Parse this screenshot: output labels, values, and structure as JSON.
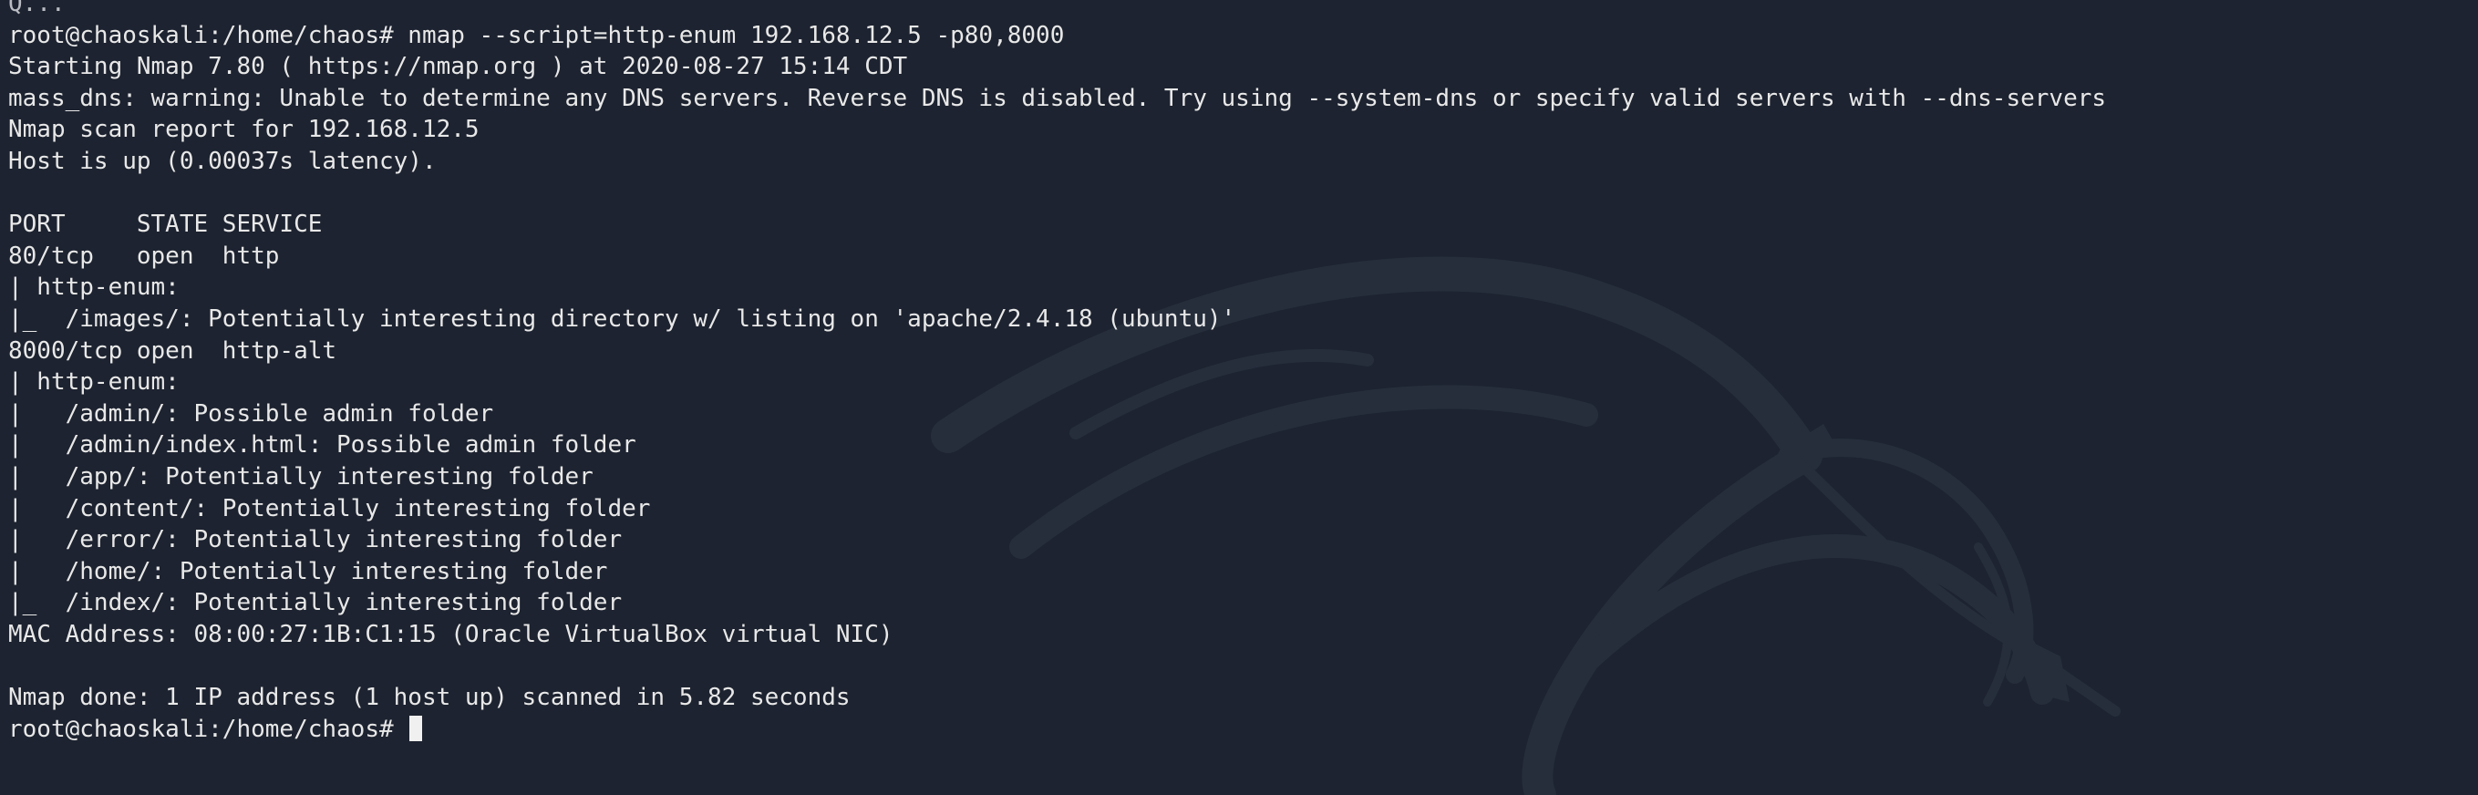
{
  "terminal": {
    "lines": [
      "Q...",
      "root@chaoskali:/home/chaos# nmap --script=http-enum 192.168.12.5 -p80,8000",
      "Starting Nmap 7.80 ( https://nmap.org ) at 2020-08-27 15:14 CDT",
      "mass_dns: warning: Unable to determine any DNS servers. Reverse DNS is disabled. Try using --system-dns or specify valid servers with --dns-servers",
      "Nmap scan report for 192.168.12.5",
      "Host is up (0.00037s latency).",
      "",
      "PORT     STATE SERVICE",
      "80/tcp   open  http",
      "| http-enum:",
      "|_  /images/: Potentially interesting directory w/ listing on 'apache/2.4.18 (ubuntu)'",
      "8000/tcp open  http-alt",
      "| http-enum:",
      "|   /admin/: Possible admin folder",
      "|   /admin/index.html: Possible admin folder",
      "|   /app/: Potentially interesting folder",
      "|   /content/: Potentially interesting folder",
      "|   /error/: Potentially interesting folder",
      "|   /home/: Potentially interesting folder",
      "|_  /index/: Potentially interesting folder",
      "MAC Address: 08:00:27:1B:C1:15 (Oracle VirtualBox virtual NIC)",
      "",
      "Nmap done: 1 IP address (1 host up) scanned in 5.82 seconds"
    ],
    "prompt": "root@chaoskali:/home/chaos# "
  },
  "colors": {
    "background": "#1d2330",
    "foreground": "#e8e8e8",
    "watermark": "#262d3b"
  },
  "icons": {
    "watermark": "kali-dragon-icon",
    "cursor": "block-cursor"
  }
}
